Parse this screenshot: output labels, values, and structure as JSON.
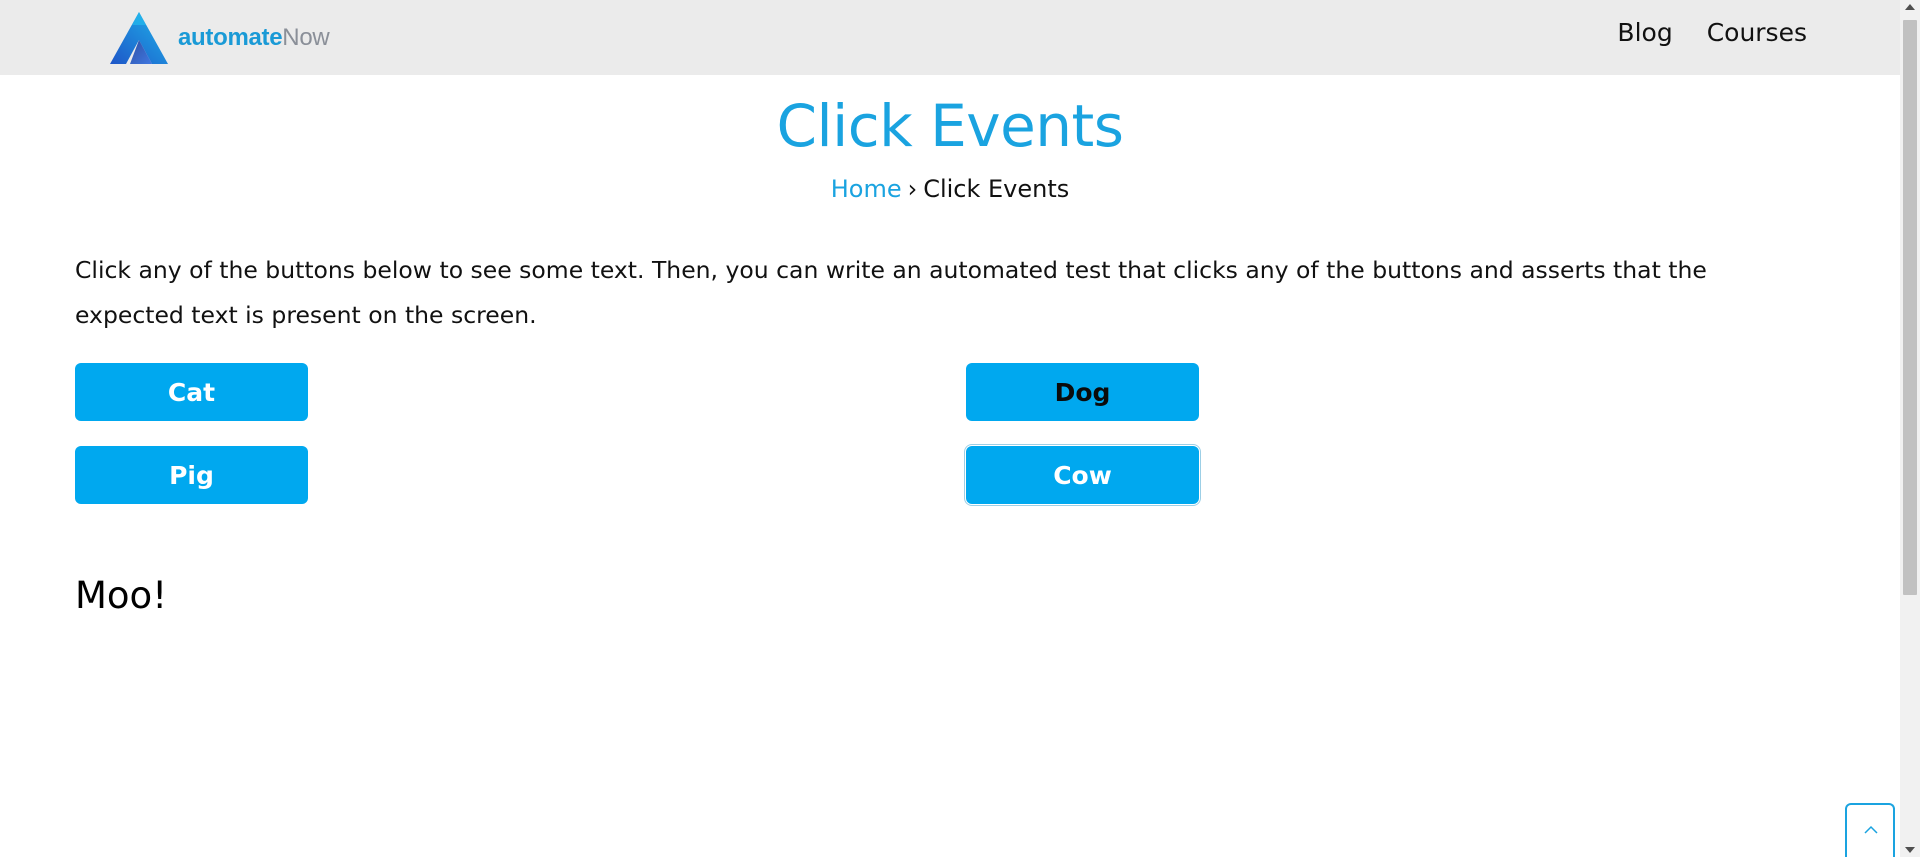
{
  "header": {
    "logo": {
      "text_bold": "automate",
      "text_light": "Now",
      "icon": "automatenow-logo-icon"
    },
    "nav": [
      {
        "label": "Blog"
      },
      {
        "label": "Courses"
      }
    ]
  },
  "main": {
    "title": "Click Events",
    "breadcrumb": {
      "home": "Home",
      "separator": "›",
      "current": "Click Events"
    },
    "description": "Click any of the buttons below to see some text. Then, you can write an automated test that clicks any of the buttons and asserts that the expected text is present on the screen.",
    "buttons": [
      {
        "label": "Cat"
      },
      {
        "label": "Dog"
      },
      {
        "label": "Pig"
      },
      {
        "label": "Cow"
      }
    ],
    "result": "Moo!"
  },
  "back_to_top": {
    "icon": "chevron-up-icon"
  },
  "colors": {
    "accent": "#1aa3e0",
    "button": "#00a8ef",
    "header_bg": "#ebebeb"
  }
}
